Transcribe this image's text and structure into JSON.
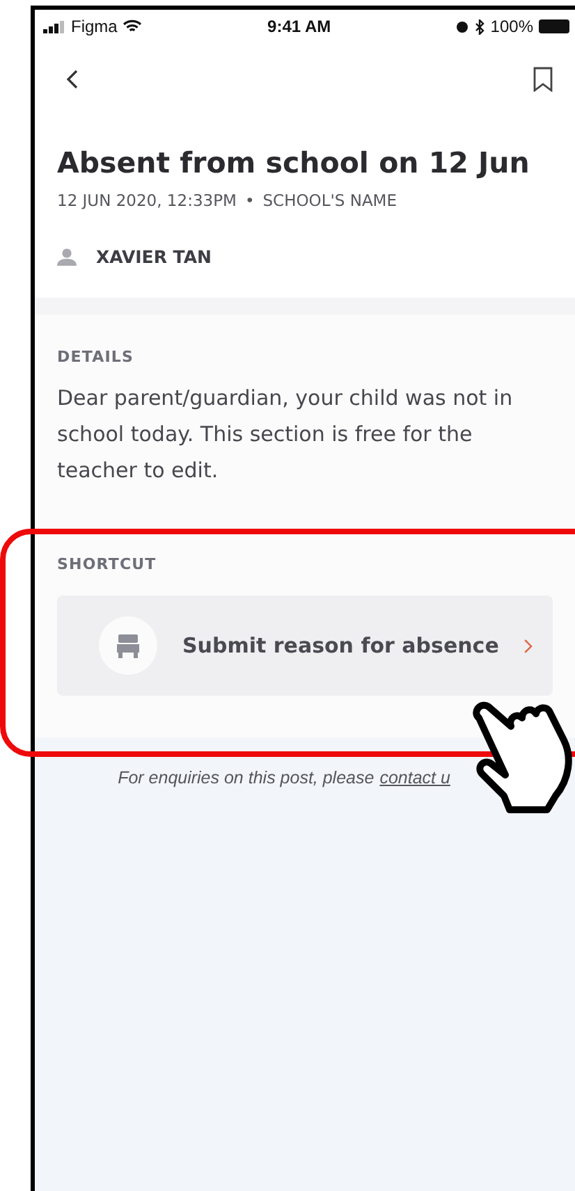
{
  "status_bar": {
    "carrier": "Figma",
    "time": "9:41 AM",
    "battery": "100%"
  },
  "post": {
    "title": "Absent from school on 12 Jun",
    "date": "12 JUN 2020, 12:33PM",
    "separator": "•",
    "school": "SCHOOL'S NAME",
    "author": "XAVIER TAN"
  },
  "details": {
    "heading": "DETAILS",
    "body": "Dear parent/guardian, your child was not in school today. This section is free for the teacher to edit."
  },
  "shortcut": {
    "heading": "SHORTCUT",
    "label": "Submit reason for absence"
  },
  "footer": {
    "text": "For enquiries on this post, please",
    "link": "contact u"
  }
}
